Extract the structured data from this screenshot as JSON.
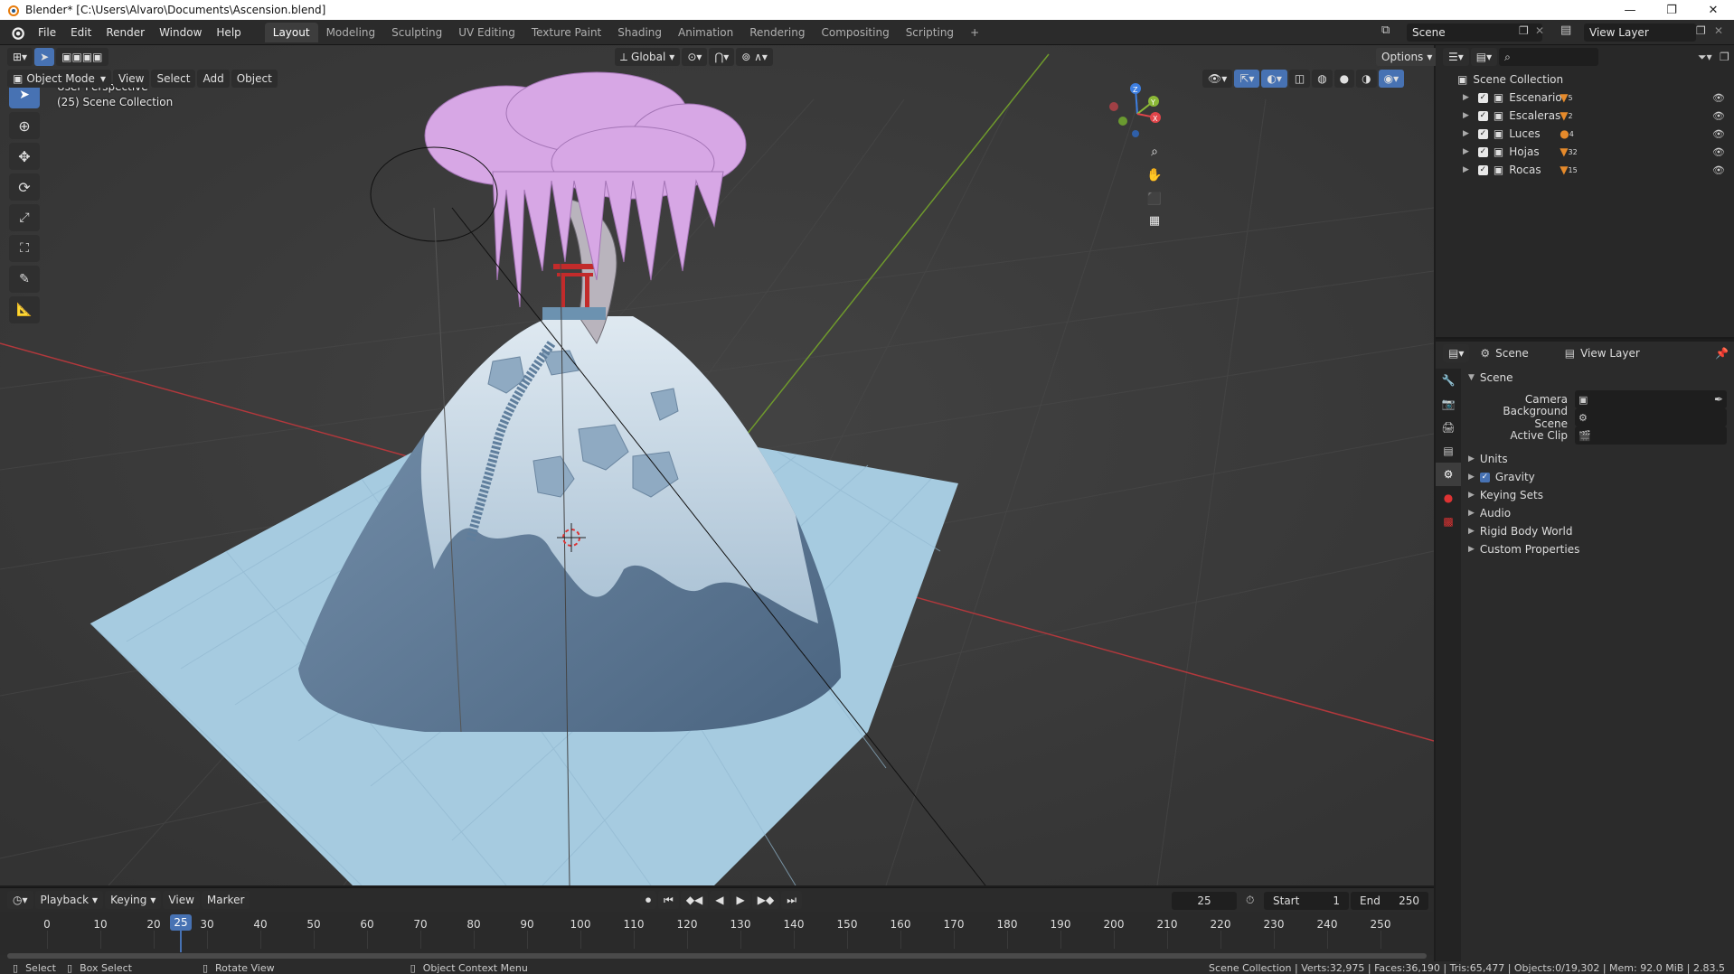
{
  "window": {
    "title": "Blender* [C:\\Users\\Alvaro\\Documents\\Ascension.blend]",
    "minimize": "—",
    "restore": "❐",
    "close": "✕"
  },
  "menu": [
    "File",
    "Edit",
    "Render",
    "Window",
    "Help"
  ],
  "workspaces": [
    "Layout",
    "Modeling",
    "Sculpting",
    "UV Editing",
    "Texture Paint",
    "Shading",
    "Animation",
    "Rendering",
    "Compositing",
    "Scripting"
  ],
  "workspace_active": "Layout",
  "workspace_add": "+",
  "scene_field": "Scene",
  "view_layer_field": "View Layer",
  "viewport_header": {
    "mode": "Object Mode",
    "view": "View",
    "select": "Select",
    "add": "Add",
    "object": "Object",
    "transform_orientation": "Global",
    "options": "Options"
  },
  "viewport_overlay": {
    "perspective": "User Perspective",
    "collection": "(25) Scene Collection"
  },
  "gizmo": {
    "x": "X",
    "y": "Y",
    "z": "Z"
  },
  "outliner": {
    "root": "Scene Collection",
    "items": [
      {
        "name": "Escenario",
        "badge": "5"
      },
      {
        "name": "Escaleras",
        "badge": "2"
      },
      {
        "name": "Luces",
        "badge": "4"
      },
      {
        "name": "Hojas",
        "badge": "32"
      },
      {
        "name": "Rocas",
        "badge": "15"
      }
    ]
  },
  "properties": {
    "header_scene": "Scene",
    "header_view_layer": "View Layer",
    "section": "Scene",
    "camera_label": "Camera",
    "background_scene_label": "Background Scene",
    "active_clip_label": "Active Clip",
    "panels": [
      "Units",
      "Gravity",
      "Keying Sets",
      "Audio",
      "Rigid Body World",
      "Custom Properties"
    ]
  },
  "timeline": {
    "playback": "Playback",
    "keying": "Keying",
    "view": "View",
    "marker": "Marker",
    "current_frame": "25",
    "start_label": "Start",
    "start_value": "1",
    "end_label": "End",
    "end_value": "250",
    "ticks": [
      "0",
      "10",
      "20",
      "25",
      "30",
      "40",
      "50",
      "60",
      "70",
      "80",
      "90",
      "100",
      "110",
      "120",
      "130",
      "140",
      "150",
      "160",
      "170",
      "180",
      "190",
      "200",
      "210",
      "220",
      "230",
      "240",
      "250"
    ]
  },
  "statusbar": {
    "select": "Select",
    "box_select": "Box Select",
    "rotate_view": "Rotate View",
    "context_menu": "Object Context Menu",
    "stats": "Scene Collection | Verts:32,975 | Faces:36,190 | Tris:65,477 | Objects:0/19,302 | Mem: 92.0 MiB | 2.83.5"
  },
  "colors": {
    "accent": "#4772b3",
    "x_axis": "#e0454a",
    "y_axis": "#8bb837",
    "z_axis": "#3d7ee0",
    "snow": "#dde9f2",
    "blossom": "#d9a8e6"
  }
}
